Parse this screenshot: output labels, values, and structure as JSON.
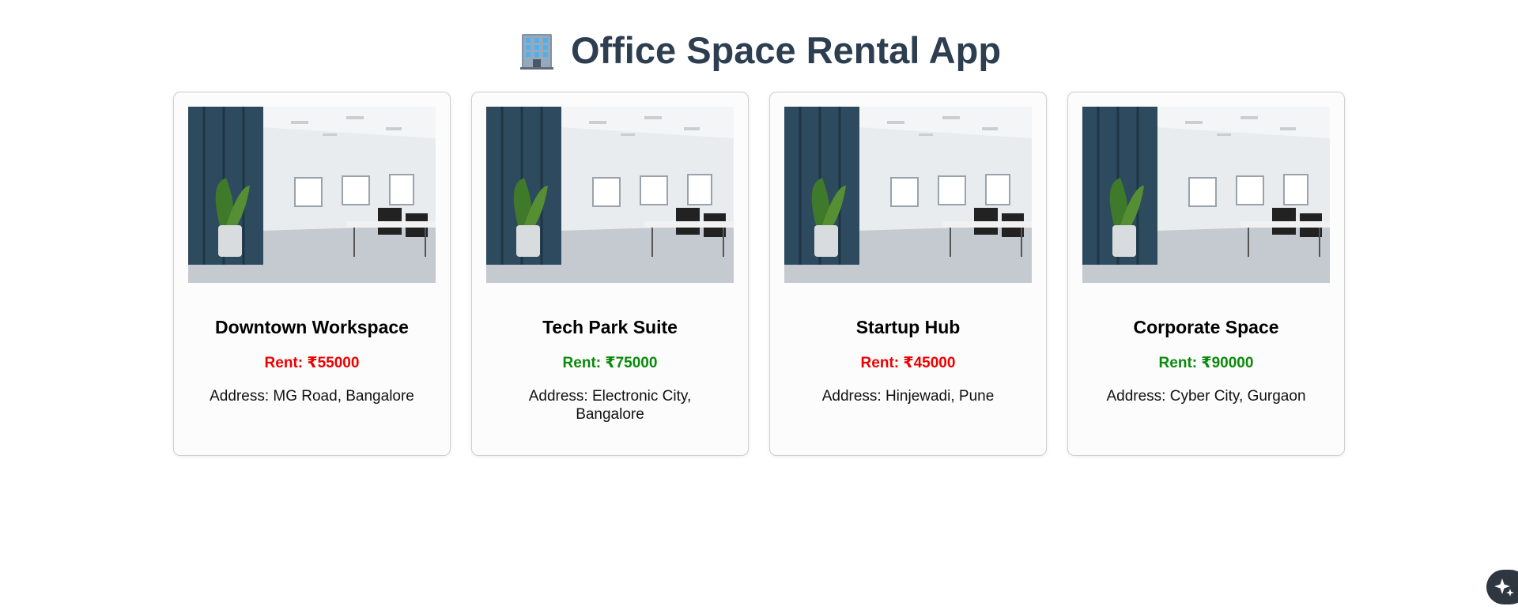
{
  "header": {
    "title": "Office Space Rental App",
    "icon": "office-building-icon"
  },
  "colors": {
    "title": "#2c3e50",
    "rent_low": "#ee0000",
    "rent_high": "#0a8a0a"
  },
  "listings": [
    {
      "name": "Downtown Workspace",
      "rent": "Rent: ₹55000",
      "address": "Address: MG Road, Bangalore",
      "rent_color": "#ee0000"
    },
    {
      "name": "Tech Park Suite",
      "rent": "Rent: ₹75000",
      "address": "Address: Electronic City, Bangalore",
      "rent_color": "#0a8a0a"
    },
    {
      "name": "Startup Hub",
      "rent": "Rent: ₹45000",
      "address": "Address: Hinjewadi, Pune",
      "rent_color": "#ee0000"
    },
    {
      "name": "Corporate Space",
      "rent": "Rent: ₹90000",
      "address": "Address: Cyber City, Gurgaon",
      "rent_color": "#0a8a0a"
    }
  ],
  "fab": {
    "icon": "sparkle-icon"
  }
}
